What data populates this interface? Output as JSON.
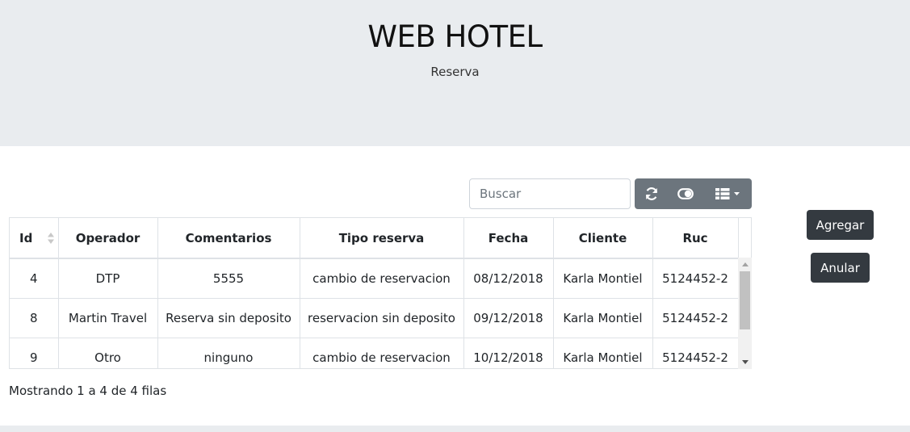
{
  "header": {
    "title": "WEB HOTEL",
    "subtitle": "Reserva"
  },
  "toolbar": {
    "search_placeholder": "Buscar",
    "refresh_icon": "refresh-icon",
    "toggle_icon": "toggle-icon",
    "columns_icon": "columns-icon"
  },
  "table": {
    "columns": [
      "Id",
      "Operador",
      "Comentarios",
      "Tipo reserva",
      "Fecha",
      "Cliente",
      "Ruc"
    ],
    "rows": [
      [
        "4",
        "DTP",
        "5555",
        "cambio de reservacion",
        "08/12/2018",
        "Karla Montiel",
        "5124452-2"
      ],
      [
        "8",
        "Martin Travel",
        "Reserva sin deposito",
        "reservacion sin deposito",
        "09/12/2018",
        "Karla Montiel",
        "5124452-2"
      ],
      [
        "9",
        "Otro",
        "ninguno",
        "cambio de reservacion",
        "10/12/2018",
        "Karla Montiel",
        "5124452-2"
      ]
    ],
    "footer": "Mostrando 1 a 4 de 4 filas"
  },
  "actions": {
    "add_label": "Agregar",
    "cancel_label": "Anular"
  },
  "colors": {
    "header_bg": "#e9ecef",
    "toolbar_btn": "#6c757d",
    "action_btn": "#343a40",
    "border": "#dee2e6"
  }
}
